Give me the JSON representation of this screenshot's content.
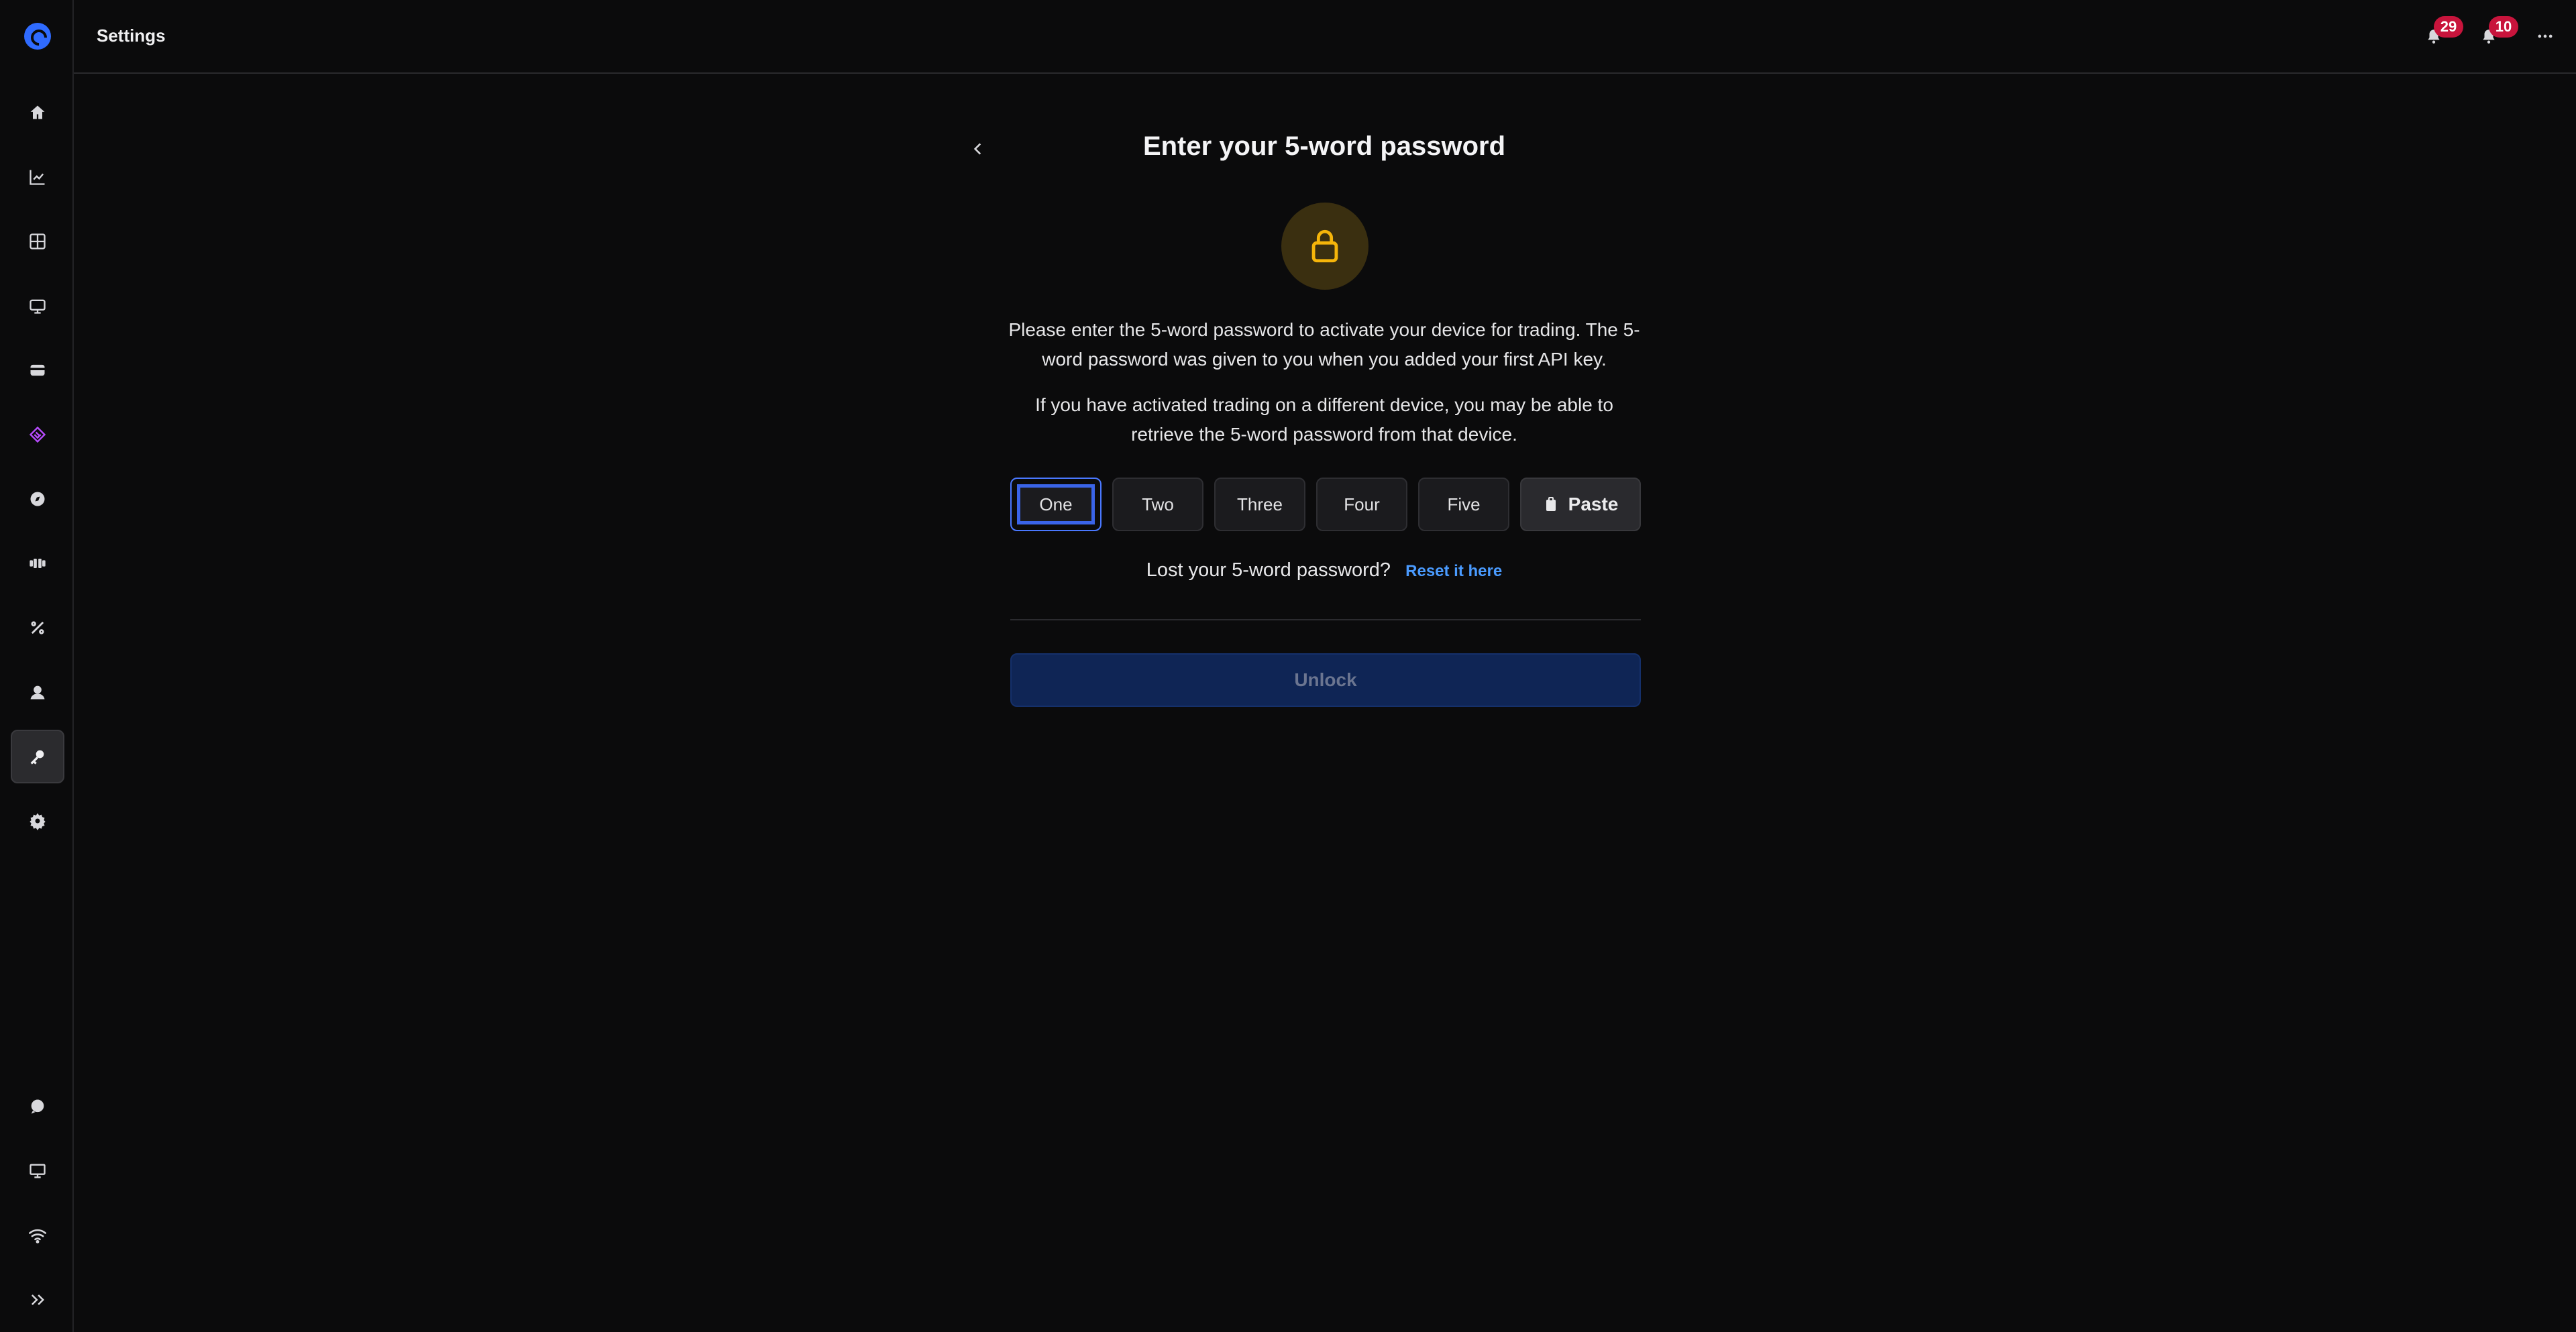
{
  "header": {
    "title": "Settings",
    "badge_a": "29",
    "badge_b": "10"
  },
  "sidebar": {
    "items": [
      "home-icon",
      "chart-icon",
      "grid-icon",
      "terminal-icon",
      "wallet-icon",
      "layers-icon",
      "compass-icon",
      "bot-icon",
      "percent-icon",
      "user-icon",
      "key-icon",
      "gear-icon"
    ],
    "active": "key-icon",
    "bottom_items": [
      "chat-icon",
      "monitor-icon",
      "wifi-icon",
      "expand-icon"
    ]
  },
  "main": {
    "heading": "Enter your 5-word password",
    "paragraph1": "Please enter the 5-word password to activate your device for trading. The 5-word password was given to you when you added your first API key.",
    "paragraph2": "If you have activated trading on a different device, you may be able to retrieve the 5-word password from that device.",
    "words": [
      {
        "placeholder": "One"
      },
      {
        "placeholder": "Two"
      },
      {
        "placeholder": "Three"
      },
      {
        "placeholder": "Four"
      },
      {
        "placeholder": "Five"
      }
    ],
    "paste_label": "Paste",
    "lost_text": "Lost your 5-word password?",
    "reset_link": "Reset it here",
    "unlock_label": "Unlock"
  },
  "colors": {
    "accent": "#2f6bff",
    "link": "#4a9bff",
    "badge": "#c8143c",
    "lock": "#f5b50a"
  }
}
